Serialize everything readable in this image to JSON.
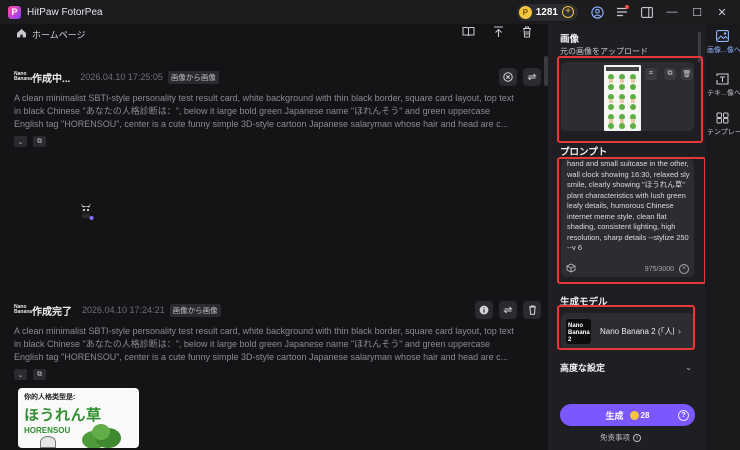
{
  "app": {
    "title": "HitPaw FotorPea",
    "logo_letter": "P"
  },
  "window_controls": {
    "credits": "1281",
    "minimize": "—",
    "maximize": "☐",
    "close": "✕"
  },
  "subbar": {
    "home_label": "ホームページ"
  },
  "feed": {
    "items": [
      {
        "status": "作成中...",
        "time": "2026.04.10  17:25:05",
        "tag": "画像から画像",
        "badge_line1": "Nano",
        "badge_line2": "Banana",
        "prompt": "A clean minimalist SBTI-style personality test result card, white background with thin black border, square card layout, top text in black Chinese \"あなたの人格診断は：\", below it large bold green Japanese name \"ほれんそう\" and green uppercase English tag \"HORENSOU\", center is a cute funny simple 3D-style cartoon Japanese salaryman whose hair and head are c..."
      },
      {
        "status": "作成完了",
        "time": "2026.04.10  17:24:21",
        "tag": "画像から画像",
        "badge_line1": "Nano",
        "badge_line2": "Banana",
        "prompt": "A clean minimalist SBTI-style personality test result card, white background with thin black border, square card layout, top text in black Chinese \"あなたの人格診断は：\", below it large bold green Japanese name \"ほれんそう\" and green uppercase English tag \"HORENSOU\", center is a cute funny simple 3D-style cartoon Japanese salaryman whose hair and head are c...",
        "thumb_line1": "你的人格类型是:",
        "thumb_line2": "ほうれん草",
        "thumb_line3": "HORENSOU"
      }
    ]
  },
  "panel": {
    "image_title": "画像",
    "upload_label": "元の画像をアップロード",
    "prompt_title": "プロンプト",
    "prompt_text": "hand and small suitcase in the other, wall clock showing 16:30, relaxed sly smile, clearly showing \"ほうれん草\" plant characteristics with lush green leafy details, humorous Chinese internet meme style, clean flat shading, consistent lighting, high resolution, sharp details --stylize 250 --v 6",
    "char_count": "975/3000",
    "model_title": "生成モデル",
    "model_logo_line1": "Nano",
    "model_logo_line2": "Banana 2",
    "model_name": "Nano Banana 2 (「人間...",
    "advanced_title": "高度な設定",
    "generate_label": "生成",
    "generate_cost": "28",
    "disclaimer": "免责事项"
  },
  "rail": {
    "items": [
      {
        "label": "画像...像へ",
        "icon": "image-to-image-icon",
        "active": true
      },
      {
        "label": "テキ...像へ",
        "icon": "text-to-image-icon",
        "active": false
      },
      {
        "label": "テンプレート",
        "icon": "template-icon",
        "active": false
      }
    ]
  },
  "colors": {
    "accent": "#7b57ff",
    "highlight": "#e53838",
    "panel_bg": "#1f1f23",
    "app_bg": "#141416"
  }
}
